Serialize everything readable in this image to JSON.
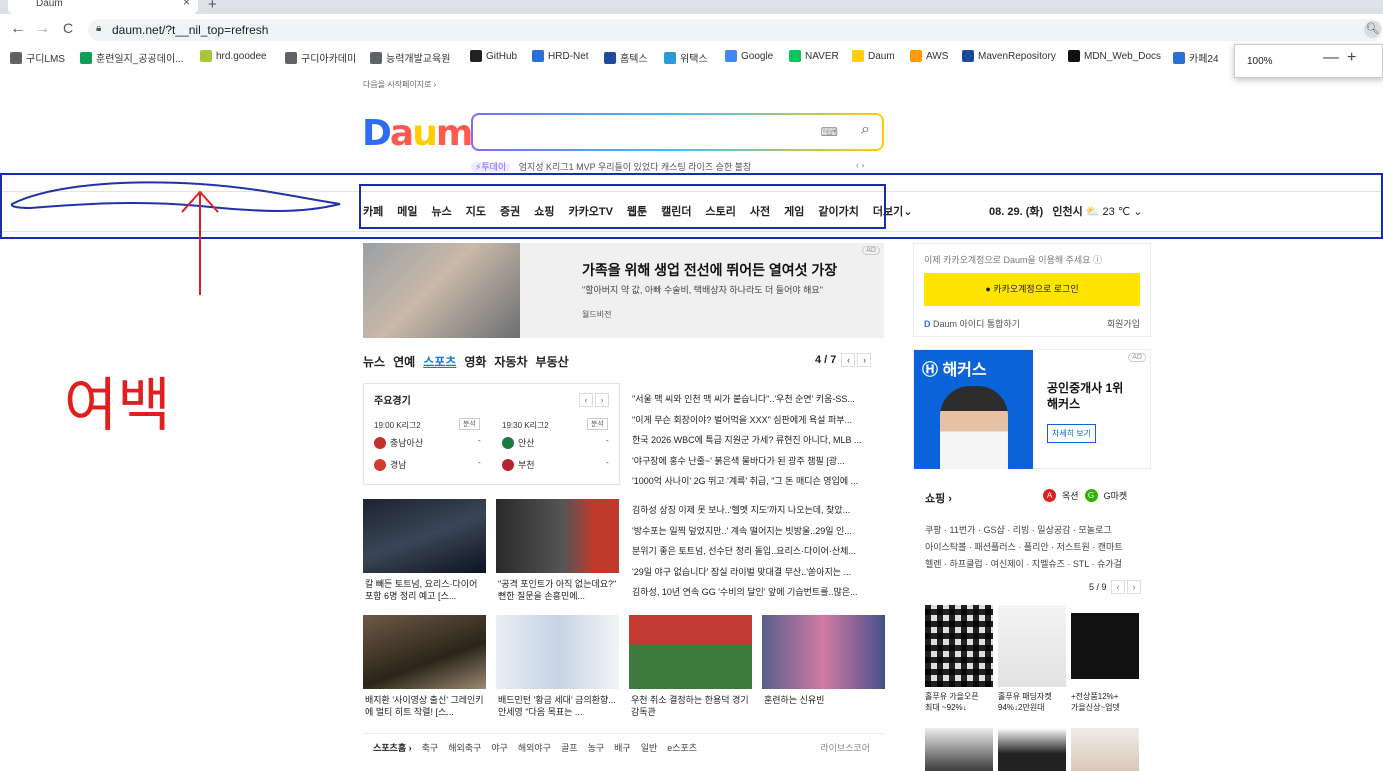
{
  "browser": {
    "tab_title": "Daum",
    "tab_close": "×",
    "new_tab": "+",
    "back": "←",
    "forward": "→",
    "reload": "C",
    "url": "daum.net/?t__nil_top=refresh",
    "bookmarks": [
      {
        "label": "구디LMS",
        "color": "#5f6368"
      },
      {
        "label": "훈련일지_공공데이...",
        "color": "#0f9d58"
      },
      {
        "label": "hrd.goodee",
        "color": "#a8c63b"
      },
      {
        "label": "구디아카데미",
        "color": "#5f6368"
      },
      {
        "label": "능력개발교육원",
        "color": "#5f6368"
      },
      {
        "label": "GitHub",
        "color": "#222222"
      },
      {
        "label": "HRD-Net",
        "color": "#2a6fd6"
      },
      {
        "label": "홈텍스",
        "color": "#1e4a9b"
      },
      {
        "label": "위택스",
        "color": "#2a9bd6"
      },
      {
        "label": "Google",
        "color": "#4285f4"
      },
      {
        "label": "NAVER",
        "color": "#03c75a"
      },
      {
        "label": "Daum",
        "color": "#ffcd00"
      },
      {
        "label": "AWS",
        "color": "#ff9900"
      },
      {
        "label": "MavenRepository",
        "color": "#1e4a9b"
      },
      {
        "label": "MDN_Web_Docs",
        "color": "#111111"
      },
      {
        "label": "카페24",
        "color": "#2a6fd6"
      }
    ],
    "zoom": {
      "level": "100%",
      "minus": "—",
      "plus": "+"
    }
  },
  "daum": {
    "start_page": "다음을 시작페이지로 ›",
    "logo": "Daum",
    "issue_tag": "⚡투데이",
    "issue_text": "엄지성 K리그1 MVP   우리들이 있었다 캐스팅   라이즈 승한 불참",
    "issue_arrows": "‹   ›",
    "nav": [
      "카페",
      "메일",
      "뉴스",
      "지도",
      "증권",
      "쇼핑",
      "카카오TV",
      "웹툰",
      "캘린더",
      "스토리",
      "사전",
      "게임",
      "같이가치",
      "더보기⌄"
    ],
    "date": "08. 29. (화)",
    "city": "인천시",
    "temp": "23 ℃ ⌄"
  },
  "annotation": {
    "handwritten_text": "여백"
  },
  "ad1": {
    "title": "가족을 위해 생업 전선에 뛰어든 열여섯 가장",
    "sub": "\"할아버지 약 값, 아빠 수술비, 택배상자 하나라도 더 들어야 해요\"",
    "source": "월드비전",
    "badge": "AD"
  },
  "news": {
    "tabs": [
      "뉴스",
      "연예",
      "스포츠",
      "영화",
      "자동차",
      "부동산"
    ],
    "active_tab": "스포츠",
    "page": "4 / 7",
    "games_title": "주요경기",
    "games": [
      {
        "time": "19:00 K리그2",
        "badge": "분석",
        "team1": "충남아산",
        "score1": "-",
        "team2": "경남",
        "score2": "-",
        "c1": "#c6302b",
        "c2": "#d13a2e"
      },
      {
        "time": "19:30 K리그2",
        "badge": "분석",
        "team1": "안산",
        "score1": "-",
        "team2": "부천",
        "score2": "-",
        "c1": "#1c7a3e",
        "c2": "#b2262f"
      }
    ],
    "headlines": [
      "\"서울 맥 씨와 인천 맥 씨가 붙습니다\"..'우천 순연' 키움-SS...",
      "\"이게 무슨 회장이야? 벌어먹을 XXX\" 심판에게 욕설 퍼부...",
      "한국 2026 WBC에 특급 지원군 가세? 류현진 아니다, MLB ...",
      "'야구장에 홍수 난줄~' 붉은색 물바다가 된 광주 챔필 [광...",
      "'1000억 사나이' 2G 뛰고 '계륵' 취급, \"그 돈 매디슨 영입에 ..."
    ],
    "headlines2": [
      "김하성 상징 이제 못 보나..'헬멧 지도'까지 나오는데, 찾았...",
      "'방수포는 일찍 덮었지만..' 계속 떨어지는 빗방울..29일 인...",
      "분위기 좋은 토트넘, 선수단 정리 돌입..요리스·다이어·산체...",
      "'29일 야구 없습니다' 잠실 라이벌 맞대결 무산..'쏟아지는 ...",
      "김하성, 10년 연속 GG '수비의 달인' 앞에 기습번트를..많은..."
    ],
    "thumb_captions": [
      "칼 빼든 토트넘, 요리스·다이어 포함 6명 정리 예고 [스...",
      "\"공격 포인트가 아직 없는데요?\" 뻔한 질문을 손흥민에...",
      "배지환 '사이영상 출신' 그레인키에 멀티 히트 작렬! [스...",
      "배드민턴 '황금 세대' 금의환향... 안세영 \"다음 목표는 ...",
      "우천 취소 결정하는 한용덕 경기감독관",
      "훈련하는 신유빈"
    ],
    "sports_bar": {
      "head": "스포츠홈 ›",
      "links": [
        "축구",
        "해외축구",
        "야구",
        "해외야구",
        "골프",
        "농구",
        "배구",
        "일반",
        "e스포츠"
      ],
      "live": "라이브스코어"
    }
  },
  "login": {
    "msg": "이제 카카오계정으로 Daum을 이용해 주세요 ⓘ",
    "button": "● 카카오계정으로 로그인",
    "integrate": "Daum 아이디 통합하기",
    "signup": "회원가입"
  },
  "ad2": {
    "brand": "해커스",
    "title": "공인중개사 1위\n해커스",
    "button": "자세히 보기",
    "badge": "AD"
  },
  "shopping": {
    "title": "쇼핑 ›",
    "auction": "옥션",
    "gmarket": "G마켓",
    "links": "쿠팡 · 11번가 · GS샵 · 리빙 · 일상공감 · 모놀로그\n아이스탁볼 · 패션플러스 · 플리안 · 저스트원 · 캔마트\n헬렌 · 하프클럽 · 여신제이 · 지멜슈즈 · STL · 슈가걸",
    "page": "5 / 9",
    "products": [
      {
        "cap": "홀푸유 가을오픈\n최대 ~92%↓"
      },
      {
        "cap": "홀푸유 패딩자켓\n94%↓2만원대"
      },
      {
        "cap": "+전상품12%+\n가을신상~업뎃"
      }
    ]
  }
}
